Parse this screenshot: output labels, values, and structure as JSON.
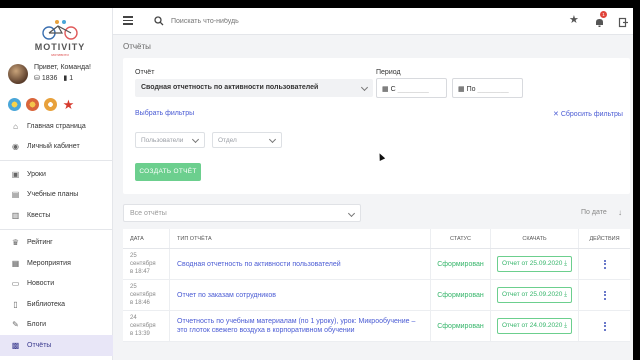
{
  "app": {
    "logo_text": "MOTIVITY",
    "logo_sub": "мотивити",
    "greeting": "Привет, Команда!",
    "coins": "1836",
    "level": "1"
  },
  "topbar": {
    "search_placeholder": "Поискать что-нибудь",
    "icons": [
      "menu-icon",
      "search-icon",
      "star-icon",
      "bell-icon",
      "logout-icon"
    ],
    "notifications_count": "1"
  },
  "sidebar": {
    "badge_colors": [
      "#4aa6d8",
      "#d9653b",
      "#e8a13b",
      "#d63a2e"
    ],
    "items": [
      {
        "label": "Главная страница",
        "icon": "home-icon"
      },
      {
        "label": "Личный кабинет",
        "icon": "user-icon"
      },
      {
        "label": "Уроки",
        "icon": "lessons-icon"
      },
      {
        "label": "Учебные планы",
        "icon": "plans-icon"
      },
      {
        "label": "Квесты",
        "icon": "quests-icon"
      },
      {
        "label": "Рейтинг",
        "icon": "rating-icon"
      },
      {
        "label": "Мероприятия",
        "icon": "events-icon"
      },
      {
        "label": "Новости",
        "icon": "news-icon"
      },
      {
        "label": "Библиотека",
        "icon": "library-icon"
      },
      {
        "label": "Блоги",
        "icon": "blogs-icon"
      },
      {
        "label": "Отчёты",
        "icon": "reports-icon",
        "active": true
      }
    ]
  },
  "page": {
    "title": "Отчёты",
    "report_label": "Отчёт",
    "report_value": "Сводная отчетность по активности пользователей",
    "period_label": "Период",
    "from_label": "С",
    "to_label": "По",
    "choose_filters": "Выбрать фильтры",
    "reset_filters": "Сбросить фильтры",
    "users_placeholder": "Пользователи",
    "department_placeholder": "Отдел",
    "create_button": "СОЗДАТЬ ОТЧЁТ",
    "all_reports": "Все отчёты",
    "sort_label": "По дате"
  },
  "table": {
    "headers": [
      "ДАТА",
      "ТИП ОТЧЁТА",
      "СТАТУС",
      "СКАЧАТЬ",
      "ДЕЙСТВИЯ"
    ],
    "rows": [
      {
        "date": "25 сентября",
        "time": "в 18:47",
        "type": "Сводная отчетность по активности пользователей",
        "status": "Сформирован",
        "download": "Отчет от 25.09.2020"
      },
      {
        "date": "25 сентября",
        "time": "в 18:46",
        "type": "Отчет по заказам сотрудников",
        "status": "Сформирован",
        "download": "Отчет от 25.09.2020"
      },
      {
        "date": "24 сентября",
        "time": "в 13:39",
        "type": "Отчетность по учебным материалам (по 1 уроку), урок: Микрообучение – это глоток свежего воздуха в корпоративном обучении",
        "status": "Сформирован",
        "download": "Отчет от 24.09.2020"
      }
    ]
  }
}
